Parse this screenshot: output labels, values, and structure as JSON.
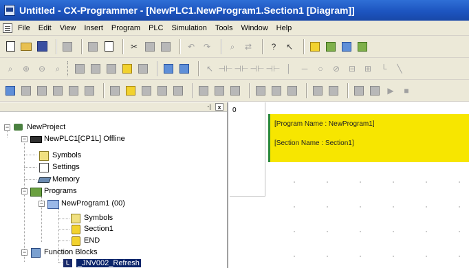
{
  "window": {
    "title": "Untitled - CX-Programmer - [NewPLC1.NewProgram1.Section1 [Diagram]]"
  },
  "menu": {
    "items": [
      "File",
      "Edit",
      "View",
      "Insert",
      "Program",
      "PLC",
      "Simulation",
      "Tools",
      "Window",
      "Help"
    ]
  },
  "toolbars": {
    "row1": [
      "new-icon",
      "open-icon",
      "save-icon",
      "print-preview-icon",
      "print-icon",
      "page-setup-icon",
      "cut-icon",
      "copy-icon",
      "paste-icon",
      "undo-icon",
      "redo-icon",
      "find-icon",
      "replace-icon",
      "help-icon",
      "context-help-icon",
      "online-icon",
      "monitor-icon"
    ],
    "row2": [
      "zoom-icon",
      "zoom-in-icon",
      "zoom-out-icon",
      "grid-icon",
      "list-icon",
      "table-icon",
      "mnemonic-icon",
      "contact-icon",
      "coil-icon",
      "instruction-icon"
    ],
    "row3": [
      "project-workspace-icon",
      "output-icon",
      "watch-icon",
      "memory-icon",
      "io-table-icon"
    ]
  },
  "project_tree": {
    "root": "NewProject",
    "plc": "NewPLC1[CP1L] Offline",
    "symbols": "Symbols",
    "settings": "Settings",
    "memory": "Memory",
    "programs": "Programs",
    "program": "NewProgram1 (00)",
    "program_symbols": "Symbols",
    "section": "Section1",
    "end": "END",
    "function_blocks": "Function Blocks",
    "fb_item": "_JNV002_Refresh"
  },
  "pane": {
    "pin_label": "-|",
    "close_label": "x"
  },
  "diagram": {
    "rung_number": "0",
    "program_comment": "[Program Name : NewProgram1]",
    "section_comment": "[Section Name : Section1]",
    "comment_color": "#f7e600",
    "rail_color": "#2e8a3a"
  }
}
